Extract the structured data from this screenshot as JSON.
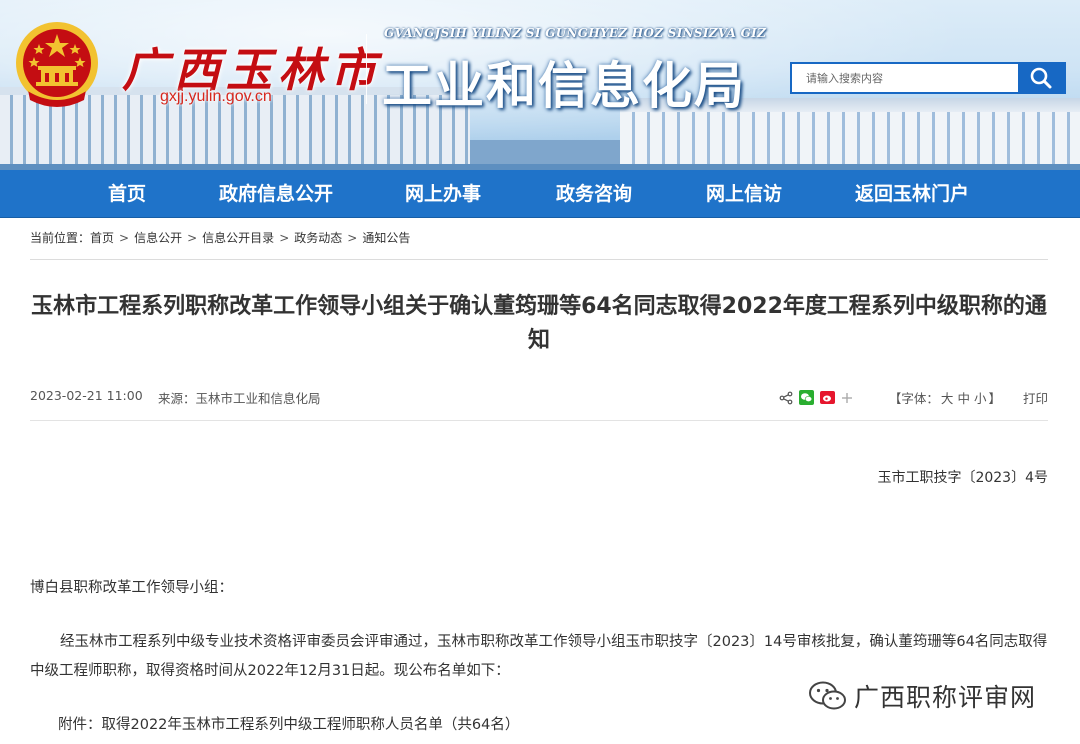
{
  "header": {
    "city_name": "广西玉林市",
    "site_url": "gxjj.yulin.gov.cn",
    "department_zhuang": "GVANGJSIH  YILINZ SI GUNGHYEZ HOZ SINSIZVA GIZ",
    "department_name": "工业和信息化局"
  },
  "search": {
    "placeholder": "请输入搜索内容",
    "icon": "search-icon"
  },
  "nav": {
    "items": [
      "首页",
      "政府信息公开",
      "网上办事",
      "政务咨询",
      "网上信访",
      "返回玉林门户"
    ]
  },
  "breadcrumb": {
    "label": "当前位置：",
    "items": [
      "首页",
      "信息公开",
      "信息公开目录",
      "政务动态",
      "通知公告"
    ],
    "separator": ">"
  },
  "article": {
    "title": "玉林市工程系列职称改革工作领导小组关于确认董筠珊等64名同志取得2022年度工程系列中级职称的通知",
    "date": "2023-02-21 11:00",
    "source": "来源：玉林市工业和信息化局",
    "font_size_label_open": "【字体：",
    "font_sizes": [
      "大",
      "中",
      "小"
    ],
    "font_size_label_close": "】",
    "print": "打印",
    "doc_number": "玉市工职技字〔2023〕4号",
    "salutation": "博白县职称改革工作领导小组：",
    "paragraph1": "经玉林市工程系列中级专业技术资格评审委员会评审通过，玉林市职称改革工作领导小组玉市职技字〔2023〕14号审核批复，确认董筠珊等64名同志取得中级工程师职称，取得资格时间从2022年12月31日起。现公布名单如下：",
    "attachment": "附件：取得2022年玉林市工程系列中级工程师职称人员名单（共64名）"
  },
  "share_icons": [
    "share-icon",
    "wechat-icon",
    "weibo-icon",
    "plus-icon"
  ],
  "watermark": {
    "text": "广西职称评审网",
    "icon": "wechat-watermark-icon"
  },
  "colors": {
    "nav_blue": "#1f73c9",
    "search_blue": "#1768c4",
    "emblem_red": "#c40d12",
    "emblem_gold": "#f2c230"
  }
}
